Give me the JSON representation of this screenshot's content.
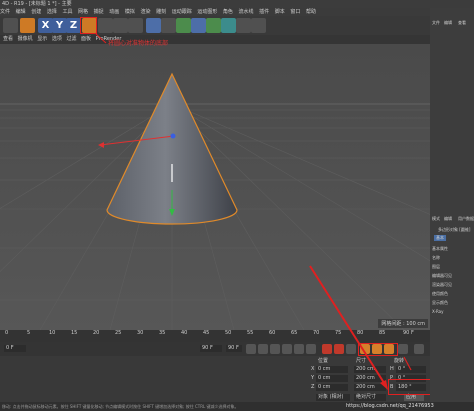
{
  "window": {
    "title": "4D - R19 - [未标题 1 *] - 主要"
  },
  "menu": {
    "items": [
      "文件",
      "编辑",
      "创建",
      "选择",
      "工具",
      "网格",
      "捕捉",
      "动画",
      "模拟",
      "渲染",
      "雕刻",
      "运动跟踪",
      "运动图形",
      "角色",
      "流水线",
      "插件",
      "脚本",
      "窗口",
      "帮助"
    ]
  },
  "viewport_menu": {
    "items": [
      "查看",
      "摄像机",
      "显示",
      "选项",
      "过滤",
      "面板",
      "ProRender"
    ]
  },
  "annotation": {
    "text": "将圆心对准物体的底部"
  },
  "viewport": {
    "grid_label": "网格间距 : 100 cm"
  },
  "timeline": {
    "ticks": [
      "0",
      "5",
      "10",
      "15",
      "20",
      "25",
      "30",
      "35",
      "40",
      "45",
      "50",
      "55",
      "60",
      "65",
      "70",
      "75",
      "80",
      "85",
      "90 F"
    ]
  },
  "transport": {
    "frame_start": "0 F",
    "frame_end": "90 F",
    "frame_total": "90 F"
  },
  "coords": {
    "headers": [
      "位置",
      "尺寸",
      "旋转"
    ],
    "rows": [
      {
        "axis": "X",
        "pos": "0 cm",
        "size": "200 cm",
        "rot_label": "H",
        "rot": "0 °"
      },
      {
        "axis": "Y",
        "pos": "0 cm",
        "size": "200 cm",
        "rot_label": "P",
        "rot": "0 °"
      },
      {
        "axis": "Z",
        "pos": "0 cm",
        "size": "200 cm",
        "rot_label": "B",
        "rot": "180 °"
      }
    ],
    "mode_select": "对象 (相对)",
    "size_select": "绝对尺寸",
    "apply_button": "应用"
  },
  "right_panel": {
    "tabs": [
      "文件",
      "编辑",
      "查看"
    ],
    "attr_tabs": [
      "模式",
      "编辑",
      "用户数据"
    ],
    "object_name": "多边形对象 [圆锥]",
    "section": "基本",
    "rows": [
      "基本属性",
      "名称",
      "图层",
      "编辑器可见",
      "渲染器可见",
      "使用颜色",
      "显示颜色",
      "X-Ray"
    ]
  },
  "status": {
    "text": "移动: 点击并拖动鼠标移动元素。按住 SHIFT 键量化移动; 节点编辑模式时按住 SHIFT 键增加选择对象; 按住 CTRL 键减少选择对象。"
  },
  "watermark": {
    "text": "https://blog.csdn.net/qq_21476953"
  }
}
